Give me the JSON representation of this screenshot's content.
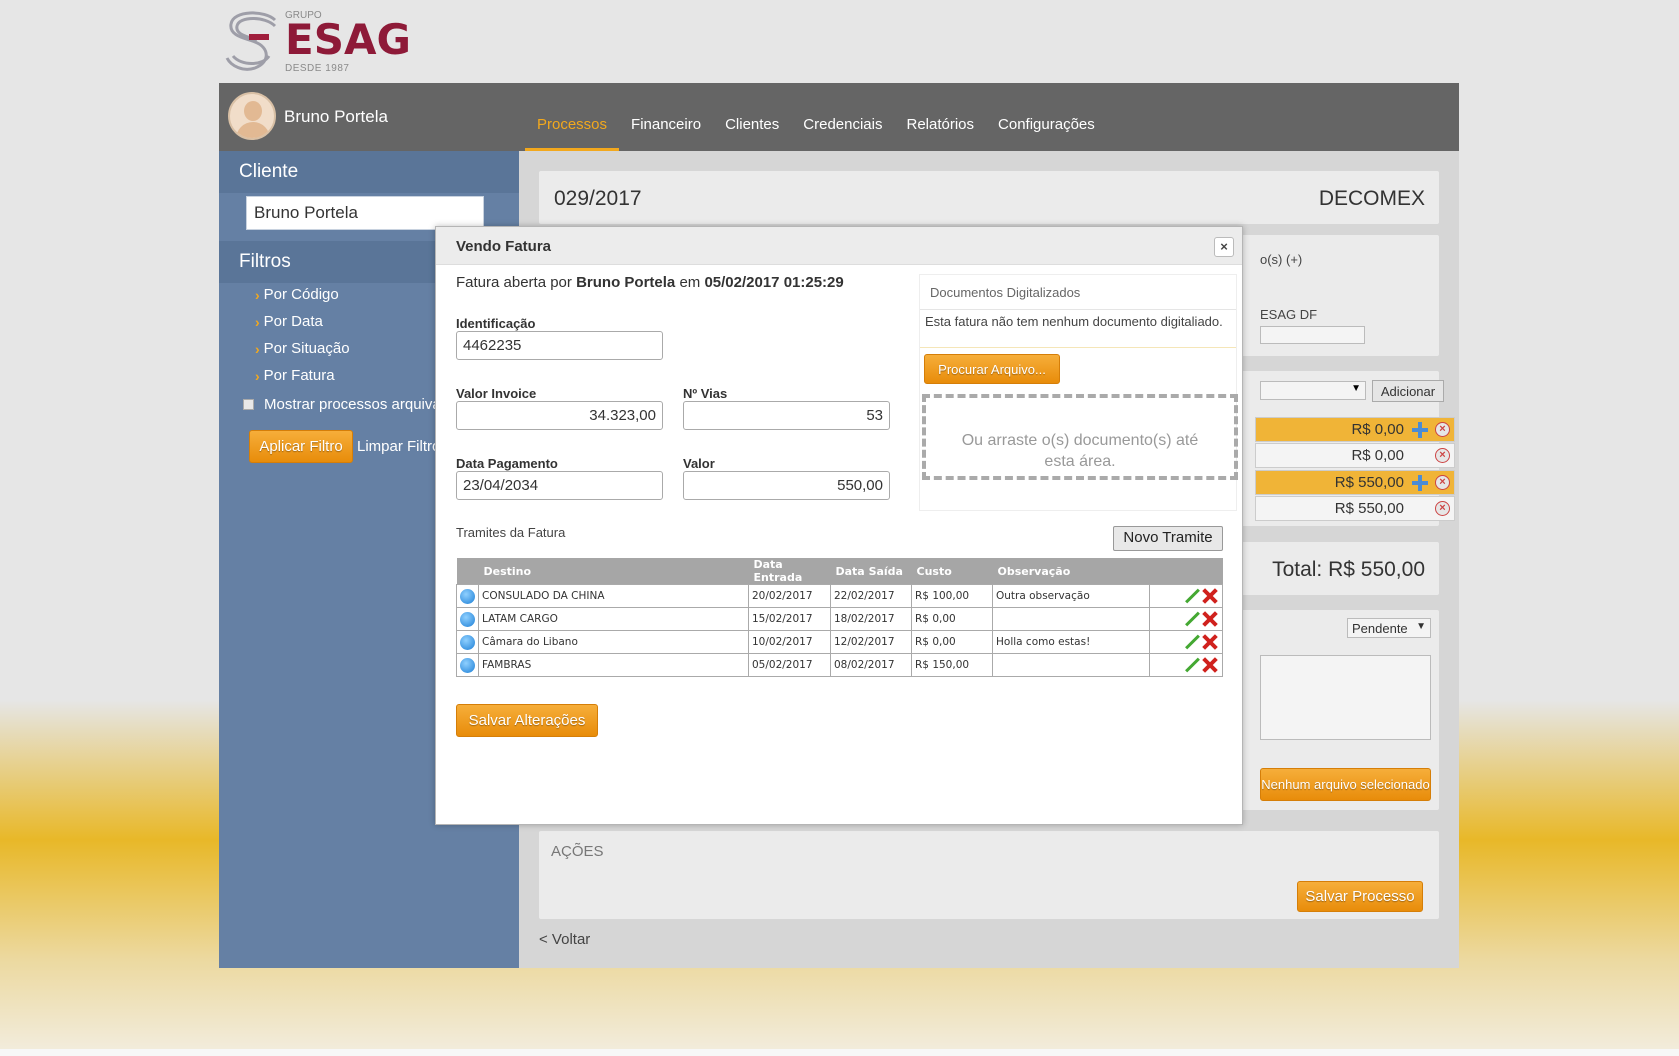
{
  "logo": {
    "grupo": "GRUPO",
    "brand": "ESAG",
    "since": "DESDE 1987"
  },
  "user": {
    "name": "Bruno Portela"
  },
  "nav": [
    {
      "label": "Processos",
      "active": true
    },
    {
      "label": "Financeiro",
      "active": false
    },
    {
      "label": "Clientes",
      "active": false
    },
    {
      "label": "Credenciais",
      "active": false
    },
    {
      "label": "Relatórios",
      "active": false
    },
    {
      "label": "Configurações",
      "active": false
    }
  ],
  "sidebar": {
    "cliente_title": "Cliente",
    "cliente_value": "Bruno Portela",
    "filtros_title": "Filtros",
    "filters": [
      "Por Código",
      "Por Data",
      "Por Situação",
      "Por Fatura"
    ],
    "show_archived": "Mostrar processos arquivados",
    "apply": "Aplicar Filtro",
    "clear": "Limpar Filtro"
  },
  "process": {
    "code": "029/2017",
    "client": "DECOMEX",
    "partial_link": "o(s) (+)",
    "partial_esag": "ESAG DF",
    "add_button": "Adicionar",
    "fees": [
      "R$ 0,00",
      "R$ 0,00",
      "R$ 550,00",
      "R$ 550,00"
    ],
    "total": "Total: R$ 550,00",
    "status": "Pendente",
    "no_file": "Nenhum arquivo selecionado",
    "acoes": "AÇÕES",
    "save_process": "Salvar Processo",
    "back": "< Voltar"
  },
  "modal": {
    "title": "Vendo Fatura",
    "close": "×",
    "opened_prefix": "Fatura aberta por",
    "opened_by": "Bruno Portela",
    "opened_mid": "em",
    "opened_at": "05/02/2017 01:25:29",
    "fields": {
      "identificacao_label": "Identificação",
      "identificacao_value": "4462235",
      "valor_invoice_label": "Valor Invoice",
      "valor_invoice_value": "34.323,00",
      "vias_label": "Nº Vias",
      "vias_value": "53",
      "data_pagamento_label": "Data Pagamento",
      "data_pagamento_value": "23/04/2034",
      "valor_label": "Valor",
      "valor_value": "550,00"
    },
    "docs": {
      "title": "Documentos Digitalizados",
      "message": "Esta fatura não tem nenhum documento digitaliado.",
      "browse": "Procurar Arquivo...",
      "drop": "Ou arraste o(s) documento(s) até esta área."
    },
    "tramites_label": "Tramites da Fatura",
    "novo_tramite": "Novo Tramite",
    "table": {
      "headers": [
        "Destino",
        "Data Entrada",
        "Data Saída",
        "Custo",
        "Observação"
      ],
      "rows": [
        [
          "CONSULADO DA CHINA",
          "20/02/2017",
          "22/02/2017",
          "R$ 100,00",
          "Outra observação"
        ],
        [
          "LATAM CARGO",
          "15/02/2017",
          "18/02/2017",
          "R$ 0,00",
          ""
        ],
        [
          "Câmara do Libano",
          "10/02/2017",
          "12/02/2017",
          "R$ 0,00",
          "Holla como estas!"
        ],
        [
          "FAMBRAS",
          "05/02/2017",
          "08/02/2017",
          "R$ 150,00",
          ""
        ]
      ]
    },
    "save": "Salvar Alterações"
  }
}
